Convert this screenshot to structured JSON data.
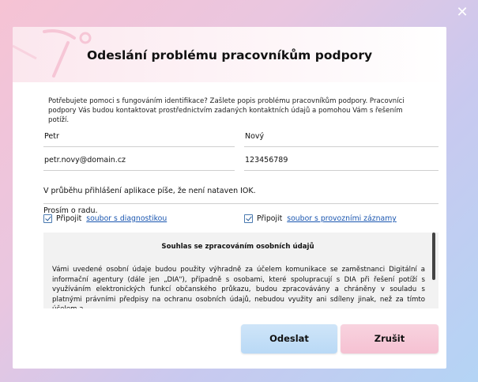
{
  "window": {
    "close_glyph": "✕"
  },
  "dialog": {
    "title": "Odeslání problému pracovníkům podpory",
    "intro": "Potřebujete pomoci s fungováním identifikace? Zašlete popis problému pracovníkům podpory. Pracovníci podpory Vás budou kontaktovat prostřednictvím zadaných kontaktních údajů a pomohou Vám s řešením potíží."
  },
  "form": {
    "first_name": "Petr",
    "last_name": "Nový",
    "email": "petr.novy@domain.cz",
    "phone": "123456789",
    "description_line1": "V průběhu přihlášení aplikace píše, že není nataven IOK.",
    "description_line2": "Prosím o radu."
  },
  "attachments": {
    "diag_prefix": "Připojit",
    "diag_link": "soubor s diagnostikou",
    "log_prefix": "Připojit",
    "log_link": "soubor s provozními záznamy"
  },
  "consent": {
    "title": "Souhlas se zpracováním osobních údajů",
    "text": "Vámi uvedené osobní údaje budou použity výhradně za účelem komunikace se zaměstnanci Digitální a informační agentury (dále jen „DIA\"), případně s osobami, které spolupracují s DIA při řešení potíží s využíváním elektronických funkcí občanského průkazu, budou zpracovávány a chráněny v souladu s platnými právními předpisy na ochranu osobních údajů, nebudou využity ani sdíleny jinak, než za tímto účelem a"
  },
  "buttons": {
    "send": "Odeslat",
    "cancel": "Zrušit"
  },
  "colors": {
    "send_bg": "#c4dff7",
    "cancel_bg": "#f6c9d8",
    "link": "#1a56b0"
  }
}
